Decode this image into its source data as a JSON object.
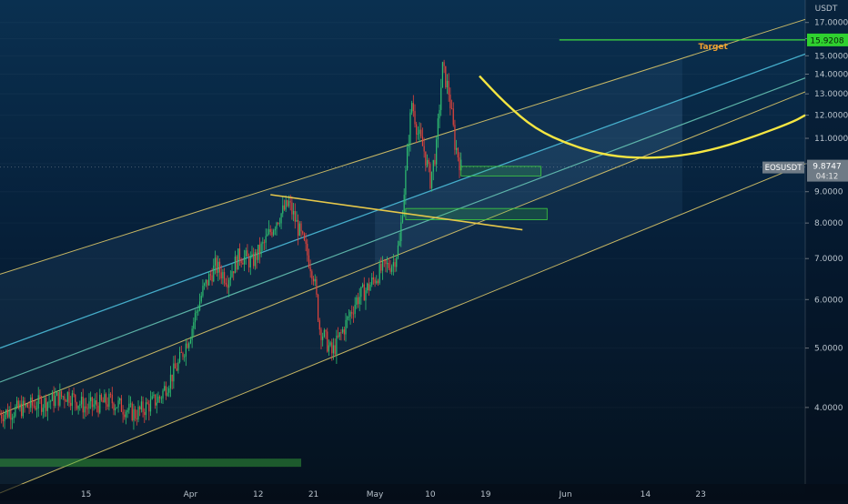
{
  "chart_data": {
    "type": "candlestick",
    "symbol": "EOSUSDT",
    "currency": "USDT",
    "price_label": "9.8747",
    "countdown": "04:12",
    "target_price_label": "15.9208",
    "target_label": "Target",
    "y_ticks": [
      "17.0000",
      "16.0000",
      "15.0000",
      "14.0000",
      "13.0000",
      "12.0000",
      "11.0000",
      "10.0000",
      "9.0000",
      "8.0000",
      "7.0000",
      "6.0000",
      "5.0000",
      "4.0000"
    ],
    "y_tick_values": [
      17,
      16,
      15,
      14,
      13,
      12,
      11,
      10,
      9,
      8,
      7,
      6,
      5,
      4
    ],
    "x_ticks": [
      "15",
      "Apr",
      "12",
      "21",
      "May",
      "10",
      "19",
      "Jun",
      "14",
      "23"
    ],
    "x_tick_dates": [
      "2021-03-15",
      "2021-04-01",
      "2021-04-12",
      "2021-04-21",
      "2021-05-01",
      "2021-05-10",
      "2021-05-19",
      "2021-06-01",
      "2021-06-14",
      "2021-06-23"
    ],
    "x_range": [
      "2021-03-01",
      "2021-07-10"
    ],
    "ylim": [
      3,
      18.5
    ],
    "scale": "log",
    "price_path": [
      [
        "2021-03-01",
        3.9
      ],
      [
        "2021-03-05",
        4.0
      ],
      [
        "2021-03-09",
        4.1
      ],
      [
        "2021-03-12",
        4.2
      ],
      [
        "2021-03-15",
        4.0
      ],
      [
        "2021-03-19",
        4.1
      ],
      [
        "2021-03-23",
        3.9
      ],
      [
        "2021-03-27",
        4.15
      ],
      [
        "2021-03-30",
        4.7
      ],
      [
        "2021-04-01",
        5.3
      ],
      [
        "2021-04-03",
        6.2
      ],
      [
        "2021-04-05",
        6.8
      ],
      [
        "2021-04-07",
        6.5
      ],
      [
        "2021-04-09",
        7.1
      ],
      [
        "2021-04-11",
        6.9
      ],
      [
        "2021-04-13",
        7.4
      ],
      [
        "2021-04-15",
        8.1
      ],
      [
        "2021-04-17",
        8.6
      ],
      [
        "2021-04-19",
        7.6
      ],
      [
        "2021-04-21",
        6.6
      ],
      [
        "2021-04-22",
        5.4
      ],
      [
        "2021-04-24",
        4.9
      ],
      [
        "2021-04-26",
        5.4
      ],
      [
        "2021-04-28",
        6.0
      ],
      [
        "2021-04-30",
        6.3
      ],
      [
        "2021-05-02",
        6.7
      ],
      [
        "2021-05-04",
        6.9
      ],
      [
        "2021-05-05",
        7.4
      ],
      [
        "2021-05-06",
        9.6
      ],
      [
        "2021-05-07",
        12.6
      ],
      [
        "2021-05-08",
        11.2
      ],
      [
        "2021-05-09",
        10.5
      ],
      [
        "2021-05-10",
        9.4
      ],
      [
        "2021-05-11",
        10.6
      ],
      [
        "2021-05-12",
        14.3
      ],
      [
        "2021-05-13",
        13.1
      ],
      [
        "2021-05-14",
        10.8
      ],
      [
        "2021-05-15",
        9.87
      ]
    ],
    "projection_points": [
      [
        "2021-05-18",
        13.9
      ],
      [
        "2021-05-22",
        12.6
      ],
      [
        "2021-05-27",
        11.4
      ],
      [
        "2021-06-02",
        10.7
      ],
      [
        "2021-06-08",
        10.3
      ],
      [
        "2021-06-14",
        10.2
      ],
      [
        "2021-06-20",
        10.3
      ],
      [
        "2021-06-26",
        10.6
      ],
      [
        "2021-07-02",
        11.1
      ],
      [
        "2021-07-08",
        11.7
      ],
      [
        "2021-07-10",
        12.0
      ]
    ],
    "channel": {
      "anchor_dates": [
        "2021-03-01",
        "2021-07-10"
      ],
      "upper": [
        6.6,
        17.2
      ],
      "mid_upper": [
        5.0,
        15.1
      ],
      "median": [
        3.9,
        13.1
      ],
      "lower": [
        2.9,
        10.0
      ],
      "extra_line": [
        4.4,
        13.8
      ]
    },
    "target_level": 15.9208,
    "descending_line": [
      [
        "2021-04-14",
        8.9
      ],
      [
        "2021-05-25",
        7.8
      ]
    ],
    "zones": [
      {
        "from": "2021-05-15",
        "to": "2021-05-28",
        "low": 9.55,
        "high": 9.9
      },
      {
        "from": "2021-05-06",
        "to": "2021-05-29",
        "low": 8.1,
        "high": 8.45
      }
    ]
  }
}
